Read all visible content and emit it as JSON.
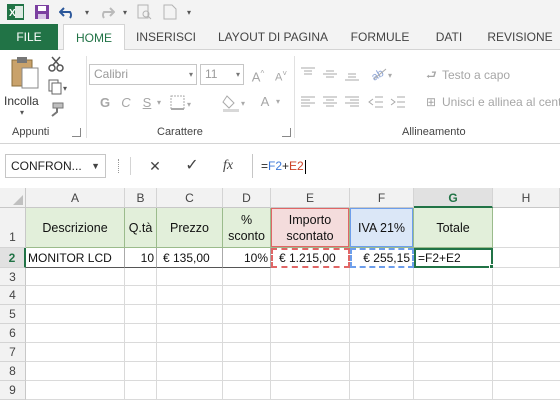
{
  "colors": {
    "excel_green": "#217346",
    "header_fill": "#e2efda",
    "ref_blue": "#3c78d8",
    "ref_red": "#cc4125"
  },
  "quick_access": {
    "icons": [
      "excel-logo-icon",
      "save-icon",
      "undo-icon",
      "redo-icon",
      "print-preview-icon",
      "new-document-icon",
      "customize-icon"
    ]
  },
  "ribbon": {
    "tabs": [
      "FILE",
      "HOME",
      "INSERISCI",
      "LAYOUT DI PAGINA",
      "FORMULE",
      "DATI",
      "REVISIONE"
    ],
    "active_tab": "HOME",
    "clipboard": {
      "paste_label": "Incolla",
      "group_label": "Appunti"
    },
    "font": {
      "font_name": "Calibri",
      "font_size": "11",
      "grow_label": "A",
      "shrink_label": "A",
      "bold_label": "G",
      "italic_label": "C",
      "underline_label": "S",
      "font_color_label": "A",
      "group_label": "Carattere"
    },
    "alignment": {
      "wrap_label": "Testo a capo",
      "merge_label": "Unisci e allinea al centro",
      "group_label": "Allineamento"
    }
  },
  "formula_bar": {
    "name_box": "CONFRON...",
    "cancel_symbol": "✕",
    "enter_symbol": "✓",
    "fx_label": "fx",
    "formula_parts": [
      "=",
      "F2",
      "+",
      "E2"
    ]
  },
  "sheet": {
    "columns": [
      "A",
      "B",
      "C",
      "D",
      "E",
      "F",
      "G",
      "H"
    ],
    "selected_column": "G",
    "rows": [
      "1",
      "2",
      "3",
      "4",
      "5",
      "6",
      "7",
      "8",
      "9",
      "10"
    ],
    "selected_row": "2",
    "header_row": [
      "Descrizione",
      "Q.tà",
      "Prezzo",
      "% sconto",
      "Importo scontato",
      "IVA 21%",
      "Totale"
    ],
    "data_row": [
      "MONITOR LCD",
      "10",
      "€ 135,00",
      "10%",
      "€ 1.215,00",
      "€ 255,15",
      "=F2+E2"
    ]
  }
}
